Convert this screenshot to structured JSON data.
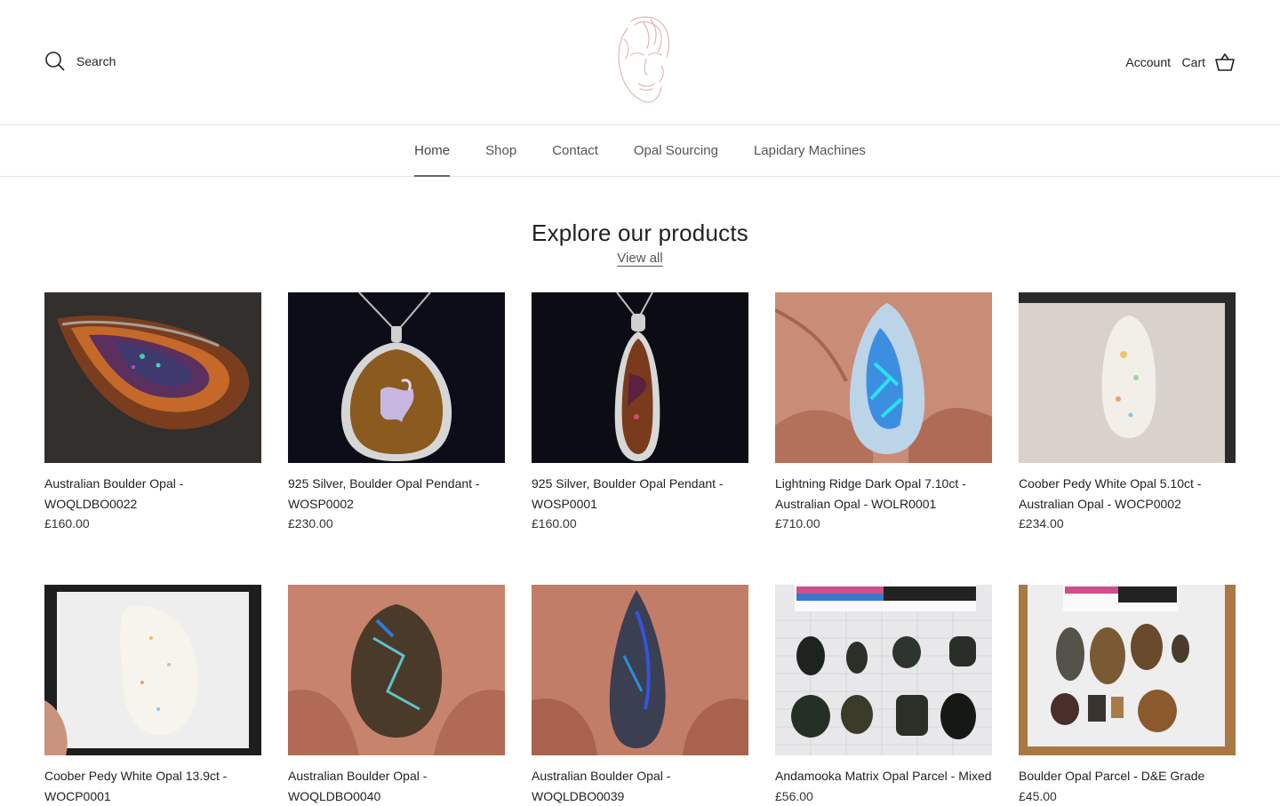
{
  "header": {
    "search_label": "Search",
    "account_label": "Account",
    "cart_label": "Cart"
  },
  "nav": {
    "items": [
      "Home",
      "Shop",
      "Contact",
      "Opal Sourcing",
      "Lapidary Machines"
    ],
    "active": "Home"
  },
  "section": {
    "title": "Explore our products",
    "view_all": "View all"
  },
  "products": [
    {
      "title": "Australian Boulder Opal - WOQLDBO0022",
      "price": "£160.00"
    },
    {
      "title": "925 Silver, Boulder Opal Pendant - WOSP0002",
      "price": "£230.00"
    },
    {
      "title": "925 Silver, Boulder Opal Pendant - WOSP0001",
      "price": "£160.00"
    },
    {
      "title": "Lightning Ridge Dark Opal 7.10ct - Australian Opal - WOLR0001",
      "price": "£710.00"
    },
    {
      "title": "Coober Pedy White Opal 5.10ct - Australian Opal - WOCP0002",
      "price": "£234.00"
    },
    {
      "title": "Coober Pedy White Opal 13.9ct - WOCP0001",
      "price": ""
    },
    {
      "title": "Australian Boulder Opal - WOQLDBO0040",
      "price": ""
    },
    {
      "title": "Australian Boulder Opal - WOQLDBO0039",
      "price": ""
    },
    {
      "title": "Andamooka Matrix Opal Parcel - Mixed",
      "price": "£56.00"
    },
    {
      "title": "Boulder Opal Parcel - D&E Grade",
      "price": "£45.00"
    }
  ],
  "icons": {
    "search": "search-icon",
    "cart": "basket-icon",
    "logo": "face-line-art-logo"
  },
  "colors": {
    "logo_stroke": "#d9b3ad",
    "nav_active_underline": "#666666"
  }
}
